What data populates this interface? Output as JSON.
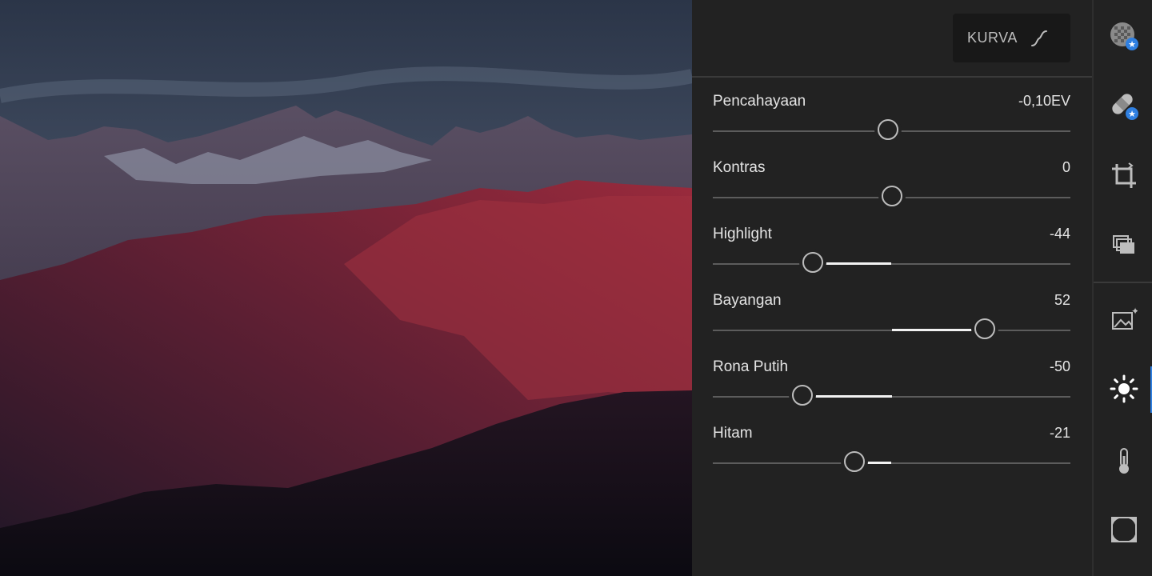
{
  "toolbar": {
    "curve_label": "KURVA",
    "curve_icon": "tone-curve-icon",
    "tools": [
      {
        "name": "presets-icon",
        "active": false
      },
      {
        "name": "healing-bandage-icon",
        "active": false
      },
      {
        "name": "crop-icon",
        "active": false
      },
      {
        "name": "versions-icon",
        "active": false
      },
      {
        "name": "auto-enhance-icon",
        "active": false
      },
      {
        "name": "light-sun-icon",
        "active": true
      },
      {
        "name": "color-thermometer-icon",
        "active": false
      },
      {
        "name": "vignette-frame-icon",
        "active": false
      }
    ],
    "active_color": "#2f7fe0"
  },
  "light_panel": {
    "sliders": [
      {
        "label": "Pencahayaan",
        "value": "-0,10EV",
        "numeric": -0.1,
        "min": -5,
        "max": 5
      },
      {
        "label": "Kontras",
        "value": "0",
        "numeric": 0,
        "min": -100,
        "max": 100
      },
      {
        "label": "Highlight",
        "value": "-44",
        "numeric": -44,
        "min": -100,
        "max": 100
      },
      {
        "label": "Bayangan",
        "value": "52",
        "numeric": 52,
        "min": -100,
        "max": 100
      },
      {
        "label": "Rona Putih",
        "value": "-50",
        "numeric": -50,
        "min": -100,
        "max": 100
      },
      {
        "label": "Hitam",
        "value": "-21",
        "numeric": -21,
        "min": -100,
        "max": 100
      }
    ]
  }
}
